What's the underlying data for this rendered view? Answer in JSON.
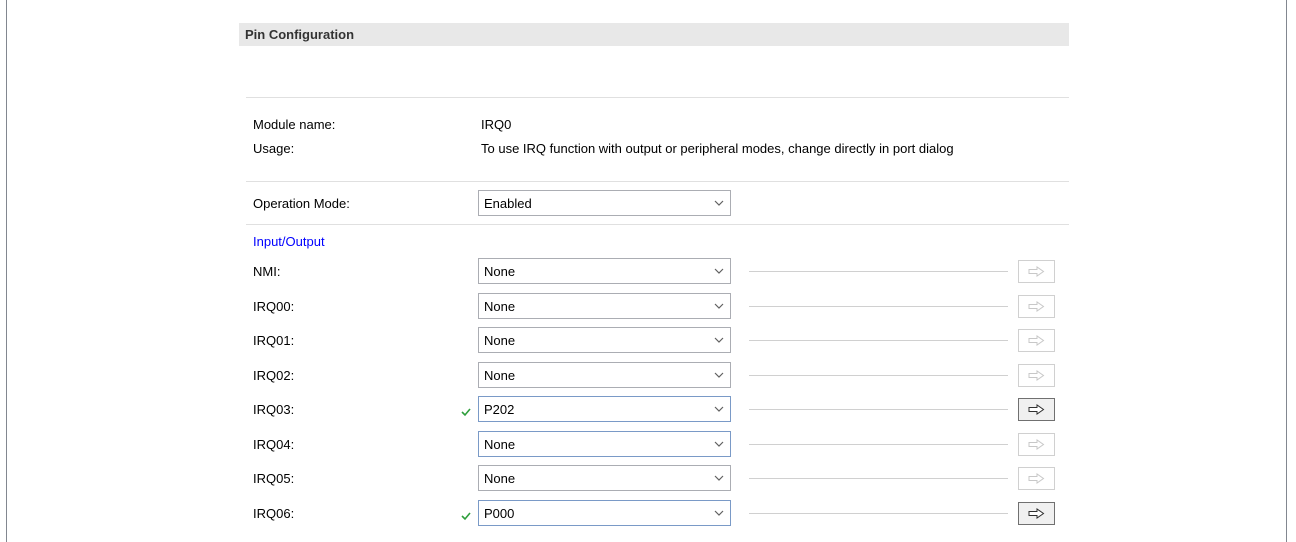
{
  "section": {
    "title": "Pin Configuration"
  },
  "module": {
    "name_label": "Module name:",
    "name_value": "IRQ0"
  },
  "usage": {
    "label": "Usage:",
    "value": "To use IRQ function with output or peripheral modes, change directly in port dialog"
  },
  "operation_mode": {
    "label": "Operation Mode:",
    "value": "Enabled"
  },
  "io_group": {
    "label": "Input/Output"
  },
  "pins": [
    {
      "label": "NMI:",
      "value": "None",
      "checked": false,
      "button_enabled": false
    },
    {
      "label": "IRQ00:",
      "value": "None",
      "checked": false,
      "button_enabled": false
    },
    {
      "label": "IRQ01:",
      "value": "None",
      "checked": false,
      "button_enabled": false
    },
    {
      "label": "IRQ02:",
      "value": "None",
      "checked": false,
      "button_enabled": false
    },
    {
      "label": "IRQ03:",
      "value": "P202",
      "checked": true,
      "button_enabled": true
    },
    {
      "label": "IRQ04:",
      "value": "None",
      "checked": false,
      "button_enabled": false
    },
    {
      "label": "IRQ05:",
      "value": "None",
      "checked": false,
      "button_enabled": false
    },
    {
      "label": "IRQ06:",
      "value": "P000",
      "checked": true,
      "button_enabled": true
    }
  ],
  "icons": {
    "dropdown": "chevron-down-icon",
    "check": "check-icon",
    "navigate": "arrow-right-icon"
  },
  "colors": {
    "group_label": "#0000ff",
    "check": "#2e9e3b",
    "header_bg": "#e8e8e8"
  }
}
